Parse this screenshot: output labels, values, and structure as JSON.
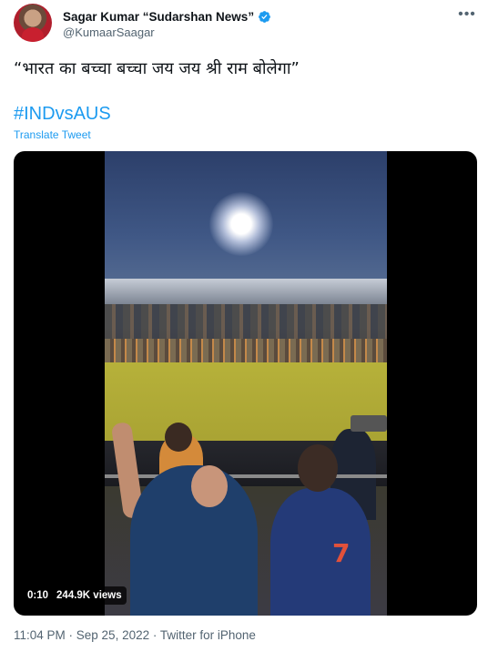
{
  "author": {
    "display_name": "Sagar Kumar “Sudarshan News”",
    "handle": "@KumaarSaagar",
    "verified": true
  },
  "tweet": {
    "text": "“भारत का बच्चा बच्चा जय जय श्री राम बोलेगा”",
    "hashtag": "#INDvsAUS",
    "translate_label": "Translate Tweet"
  },
  "video": {
    "elapsed": "0:10",
    "views": "244.9K views",
    "jersey_number": "7"
  },
  "meta": {
    "timestamp": "11:04 PM · Sep 25, 2022 · Twitter for iPhone"
  },
  "icons": {
    "more": "more-options-icon",
    "verified": "verified-badge-icon"
  },
  "colors": {
    "link": "#1d9bf0",
    "secondary_text": "#536471",
    "primary_text": "#0f1419"
  }
}
